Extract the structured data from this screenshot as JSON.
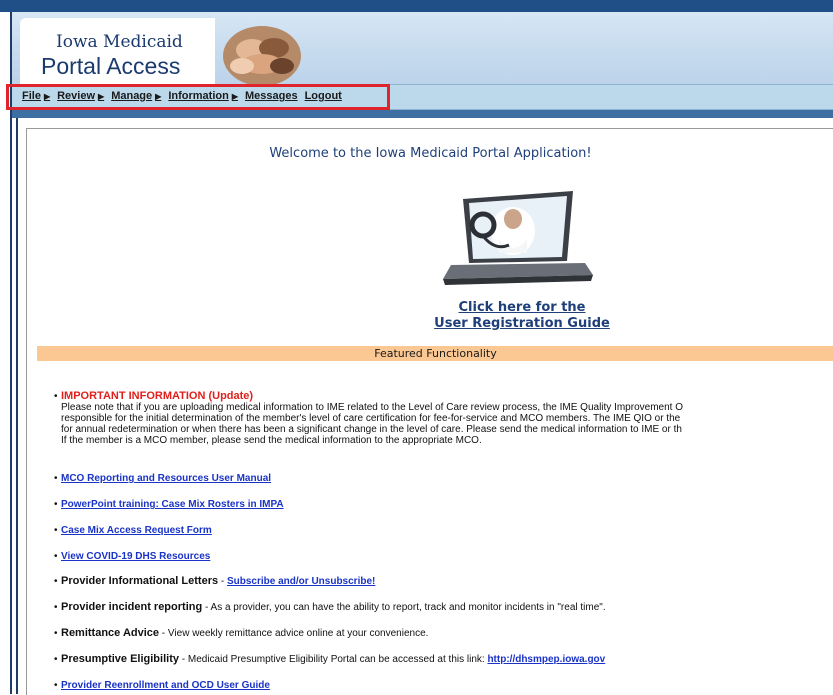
{
  "banner": {
    "line1": "Iowa Medicaid",
    "line2": "Portal Access"
  },
  "nav": {
    "file": "File",
    "review": "Review",
    "manage": "Manage",
    "information": "Information",
    "messages": "Messages",
    "logout": "Logout"
  },
  "main": {
    "welcome": "Welcome to the Iowa Medicaid Portal Application!",
    "reg_link_line1": "Click here for the",
    "reg_link_line2": "User Registration Guide",
    "featured": "Featured Functionality"
  },
  "important": {
    "title": "IMPORTANT INFORMATION (Update)",
    "lines": [
      "Please note that if you are uploading medical information to IME related to the Level of Care review process, the IME Quality Improvement O",
      "responsible for the initial determination of the member's level of care certification for fee-for-service and MCO members. The IME QIO or the",
      "for annual redetermination or when there has been a significant change in the level of care. Please send the medical information to IME or th",
      "If the member is a MCO member, please send the medical information to the appropriate MCO."
    ]
  },
  "links": {
    "mco_manual": "MCO Reporting and Resources User Manual",
    "ppt_training": "PowerPoint training: Case Mix Rosters in IMPA",
    "case_mix_form": "Case Mix Access Request Form",
    "covid": "View COVID-19 DHS Resources",
    "reenrollment": "Provider Reenrollment and OCD User Guide"
  },
  "letters": {
    "lead": "Provider Informational Letters",
    "sep": " - ",
    "link": "Subscribe and/or Unsubscribe!"
  },
  "incident": {
    "lead": "Provider incident reporting",
    "text": " - As a provider, you can have the ability to report, track and monitor incidents in \"real time\"."
  },
  "remittance": {
    "lead": "Remittance Advice",
    "text": " - View weekly remittance advice online at your convenience."
  },
  "presumptive": {
    "lead": "Presumptive Eligibility",
    "text": " - Medicaid Presumptive Eligibility Portal can be accessed at this link: ",
    "link": "http://dhsmpep.iowa.gov"
  },
  "colors": {
    "banner_blue": "#1f4f86",
    "nav_bg": "#bcd9ec",
    "highlight_red": "#e0242b",
    "featured_orange": "#fbc893",
    "link_blue": "#1a33c7",
    "important_red": "#e0201c"
  }
}
